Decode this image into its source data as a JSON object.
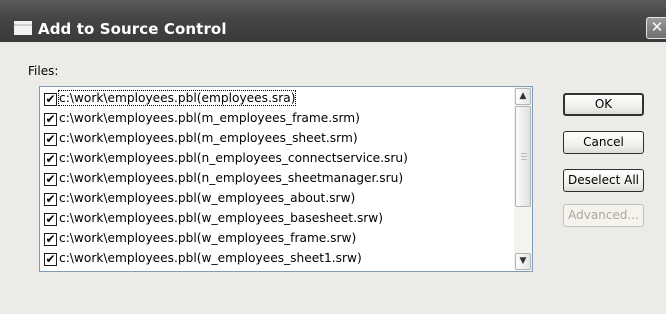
{
  "window": {
    "title": "Add to Source Control",
    "close_glyph": "✕"
  },
  "files_label": "Files:",
  "files": [
    {
      "label": "c:\\work\\employees.pbl(employees.sra)",
      "checked": true
    },
    {
      "label": "c:\\work\\employees.pbl(m_employees_frame.srm)",
      "checked": true
    },
    {
      "label": "c:\\work\\employees.pbl(m_employees_sheet.srm)",
      "checked": true
    },
    {
      "label": "c:\\work\\employees.pbl(n_employees_connectservice.sru)",
      "checked": true
    },
    {
      "label": "c:\\work\\employees.pbl(n_employees_sheetmanager.sru)",
      "checked": true
    },
    {
      "label": "c:\\work\\employees.pbl(w_employees_about.srw)",
      "checked": true
    },
    {
      "label": "c:\\work\\employees.pbl(w_employees_basesheet.srw)",
      "checked": true
    },
    {
      "label": "c:\\work\\employees.pbl(w_employees_frame.srw)",
      "checked": true
    },
    {
      "label": "c:\\work\\employees.pbl(w_employees_sheet1.srw)",
      "checked": true
    }
  ],
  "check_glyph": "✔",
  "scroll": {
    "up_glyph": "▲",
    "down_glyph": "▼"
  },
  "buttons": {
    "ok": "OK",
    "cancel": "Cancel",
    "deselect_all": "Deselect All",
    "advanced": "Advanced..."
  }
}
